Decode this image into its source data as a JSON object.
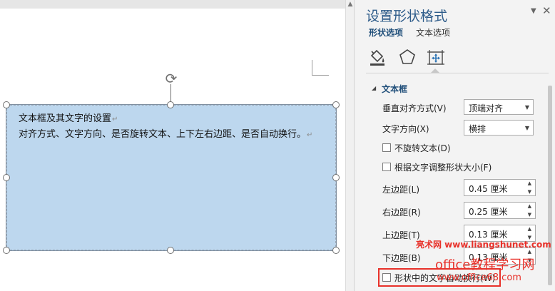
{
  "document": {
    "shape_text_line1": "文本框及其文字的设置",
    "shape_text_line2": "对齐方式、文字方向、是否旋转文本、上下左右边距、是否自动换行。",
    "paragraph_mark": "↵",
    "shape_fill_color": "#bdd7ee"
  },
  "pane": {
    "title": "设置形状格式",
    "dropdown_icon": "▼",
    "close_icon": "✕",
    "tabs": {
      "shape_options": "形状选项",
      "text_options": "文本选项"
    },
    "category_icons": [
      "fill-line-icon",
      "effects-pentagon-icon",
      "layout-properties-icon"
    ],
    "section": {
      "arrow": "◢",
      "title": "文本框"
    },
    "vertical_align": {
      "label": "垂直对齐方式(V)",
      "value": "顶端对齐"
    },
    "text_direction": {
      "label": "文字方向(X)",
      "value": "横排"
    },
    "no_rotate": {
      "label": "不旋转文本(D)",
      "checked": false
    },
    "autofit": {
      "label": "根据文字调整形状大小(F)",
      "checked": false
    },
    "left_margin": {
      "label": "左边距(L)",
      "value": "0.45 厘米"
    },
    "right_margin": {
      "label": "右边距(R)",
      "value": "0.25 厘米"
    },
    "top_margin": {
      "label": "上边距(T)",
      "value": "0.13 厘米"
    },
    "bottom_margin": {
      "label": "下边距(B)",
      "value": "0.13 厘米"
    },
    "wrap_text": {
      "label": "形状中的文字自动换行(W)",
      "checked": false
    }
  },
  "watermark": {
    "site": "亮术网 www.liangshunet.com",
    "office_title": "office教程学习网",
    "office_url": "www.office68.com"
  },
  "accent_colors": {
    "pane_title": "#2e5c8a",
    "watermark": "#e8312a"
  }
}
